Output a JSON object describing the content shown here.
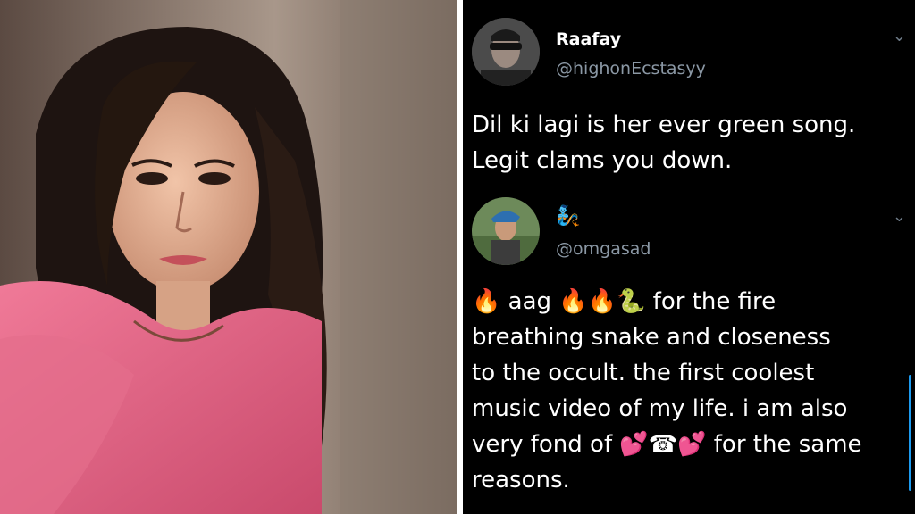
{
  "photo": {
    "alt_icon": "portrait-photo"
  },
  "tweets": [
    {
      "name": "Raafay",
      "handle": "@highonEcstasyy",
      "text_lines": [
        "Dil ki lagi is her ever green song.",
        "Legit clams you down."
      ]
    },
    {
      "name": "🧞",
      "handle": "@omgasad",
      "line1_a": "🔥",
      "line1_b": " aag ",
      "line1_c": "🔥🔥🐍",
      "line1_d": "  for the fire",
      "line2": "breathing snake and closeness",
      "line3": "to the occult. the first coolest",
      "line4": "music video of my life. i am also",
      "line5_a": "very fond of ",
      "line5_b": "💕☎💕",
      "line5_c": "  for the same",
      "line6": "reasons."
    }
  ],
  "chevron_glyph": "⌄",
  "colors": {
    "background": "#000000",
    "handle": "#8b98a5",
    "accent": "#1d9bf0"
  }
}
